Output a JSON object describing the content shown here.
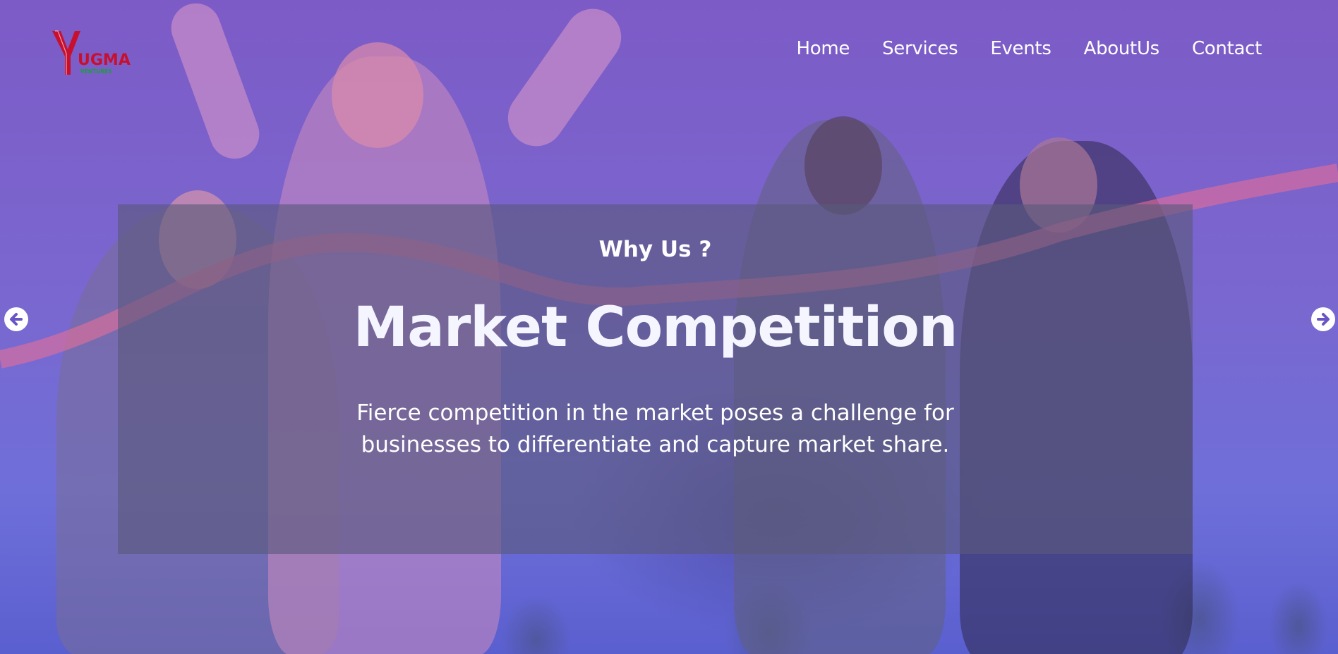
{
  "brand": {
    "logo_text": "UGMA",
    "logo_subtext": "VENTURES",
    "logo_color": "#c8102e",
    "logo_sub_color": "#1a9e3c"
  },
  "nav": {
    "items": [
      "Home",
      "Services",
      "Events",
      "AboutUs",
      "Contact"
    ]
  },
  "hero": {
    "eyebrow": "Why Us ?",
    "title": "Market Competition",
    "description": "Fierce competition in the market poses a challenge for businesses to differentiate and capture market share.",
    "overlay_color": "#6a55c4"
  },
  "carousel": {
    "prev_icon": "arrow-left-circle-icon",
    "next_icon": "arrow-right-circle-icon"
  }
}
